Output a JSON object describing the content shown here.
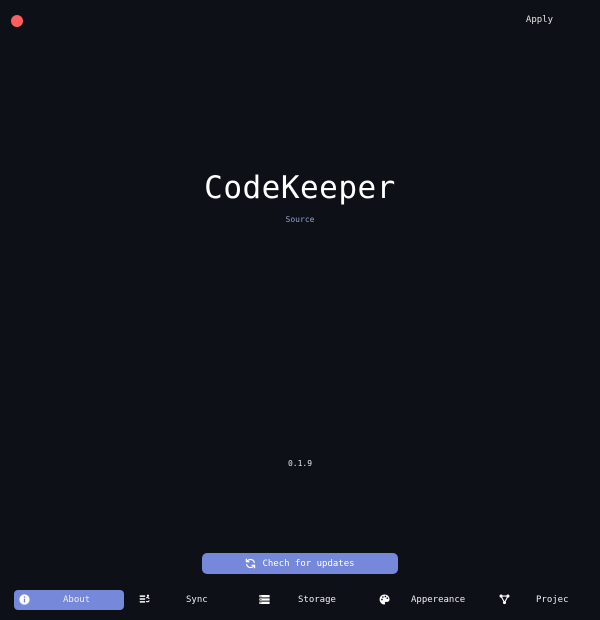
{
  "window": {
    "apply_label": "Apply"
  },
  "app": {
    "name": "CodeKeeper",
    "source_label": "Source",
    "version": "0.1.9"
  },
  "actions": {
    "check_updates_label": "Chech for updates"
  },
  "nav": {
    "items": [
      {
        "label": "About",
        "icon": "info-icon",
        "active": true
      },
      {
        "label": "Sync",
        "icon": "sync-icon",
        "active": false
      },
      {
        "label": "Storage",
        "icon": "storage-icon",
        "active": false
      },
      {
        "label": "Appereance",
        "icon": "palette-icon",
        "active": false
      },
      {
        "label": "Projec",
        "icon": "project-icon",
        "active": false
      }
    ]
  },
  "colors": {
    "background": "#0d1017",
    "accent": "#7688d9",
    "close": "#ff5f5f",
    "link": "#8fa2cf"
  }
}
